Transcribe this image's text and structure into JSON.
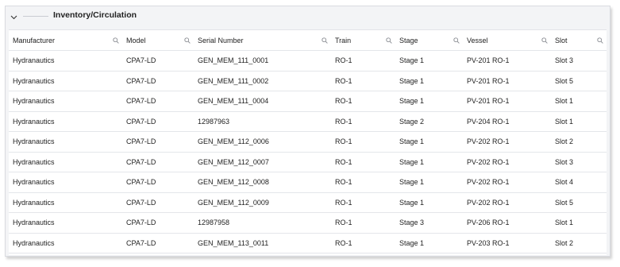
{
  "panel": {
    "title": "Inventory/Circulation",
    "collapse_icon": "chevron-down-icon"
  },
  "table": {
    "columns": [
      {
        "label": "Manufacturer",
        "icon": "search-icon"
      },
      {
        "label": "Model",
        "icon": "search-icon"
      },
      {
        "label": "Serial Number",
        "icon": "search-icon"
      },
      {
        "label": "Train",
        "icon": "search-icon"
      },
      {
        "label": "Stage",
        "icon": "search-icon"
      },
      {
        "label": "Vessel",
        "icon": "search-icon"
      },
      {
        "label": "Slot",
        "icon": "search-icon"
      }
    ],
    "rows": [
      [
        "Hydranautics",
        "CPA7-LD",
        "GEN_MEM_111_0001",
        "RO-1",
        "Stage 1",
        "PV-201 RO-1",
        "Slot 3"
      ],
      [
        "Hydranautics",
        "CPA7-LD",
        "GEN_MEM_111_0002",
        "RO-1",
        "Stage 1",
        "PV-201 RO-1",
        "Slot 5"
      ],
      [
        "Hydranautics",
        "CPA7-LD",
        "GEN_MEM_111_0004",
        "RO-1",
        "Stage 1",
        "PV-201 RO-1",
        "Slot 1"
      ],
      [
        "Hydranautics",
        "CPA7-LD",
        "12987963",
        "RO-1",
        "Stage 2",
        "PV-204 RO-1",
        "Slot 1"
      ],
      [
        "Hydranautics",
        "CPA7-LD",
        "GEN_MEM_112_0006",
        "RO-1",
        "Stage 1",
        "PV-202 RO-1",
        "Slot 2"
      ],
      [
        "Hydranautics",
        "CPA7-LD",
        "GEN_MEM_112_0007",
        "RO-1",
        "Stage 1",
        "PV-202 RO-1",
        "Slot 3"
      ],
      [
        "Hydranautics",
        "CPA7-LD",
        "GEN_MEM_112_0008",
        "RO-1",
        "Stage 1",
        "PV-202 RO-1",
        "Slot 4"
      ],
      [
        "Hydranautics",
        "CPA7-LD",
        "GEN_MEM_112_0009",
        "RO-1",
        "Stage 1",
        "PV-202 RO-1",
        "Slot 5"
      ],
      [
        "Hydranautics",
        "CPA7-LD",
        "12987958",
        "RO-1",
        "Stage 3",
        "PV-206 RO-1",
        "Slot 1"
      ],
      [
        "Hydranautics",
        "CPA7-LD",
        "GEN_MEM_113_0011",
        "RO-1",
        "Stage 1",
        "PV-203 RO-1",
        "Slot 2"
      ]
    ]
  }
}
